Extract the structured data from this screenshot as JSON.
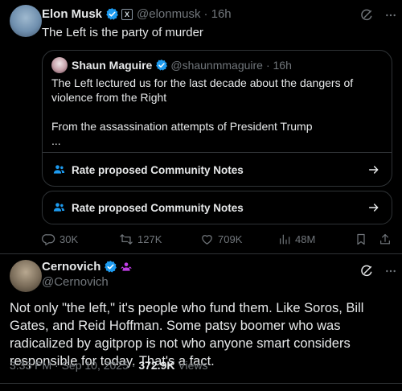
{
  "tweet1": {
    "name": "Elon Musk",
    "handle": "@elonmusk",
    "time": "· 16h",
    "text": "The Left is the party of murder",
    "x_badge": "X"
  },
  "quote": {
    "name": "Shaun Maguire",
    "handle": "@shaunmmaguire",
    "time": "· 16h",
    "line1": "The Left lectured us for the last decade about the dangers of violence from the Right",
    "line2": "From the assassination attempts of President Trump",
    "ellipsis": "...",
    "notes_label": "Rate proposed Community Notes"
  },
  "notes_button": {
    "label": "Rate proposed Community Notes"
  },
  "actions": {
    "replies": "30K",
    "reposts": "127K",
    "likes": "709K",
    "views": "48M"
  },
  "tweet2": {
    "name": "Cernovich",
    "handle": "@Cernovich",
    "text": "Not only \"the left,\" it's people who fund them. Like Soros, Bill Gates, and Reid Hoffman. Some patsy boomer who was radicalized by agitprop is not who anyone smart considers responsible for today. That's a fact.",
    "timestamp": "3:33 PM · Sep 10, 2025 · ",
    "views_count": "372.9K",
    "views_label": " Views"
  },
  "colors": {
    "background": "#000000",
    "text": "#e7e9ea",
    "muted": "#71767b",
    "verified": "#1d9bf0",
    "notes_icon": "#1d9bf0",
    "border": "#2f3336",
    "badge_purple": "#c13ee6"
  },
  "icons": [
    "verified-badge-icon",
    "x-affiliation-icon",
    "grok-icon",
    "more-icon",
    "people-icon",
    "arrow-right-icon",
    "reply-icon",
    "repost-icon",
    "like-icon",
    "views-icon",
    "bookmark-icon",
    "share-icon"
  ]
}
